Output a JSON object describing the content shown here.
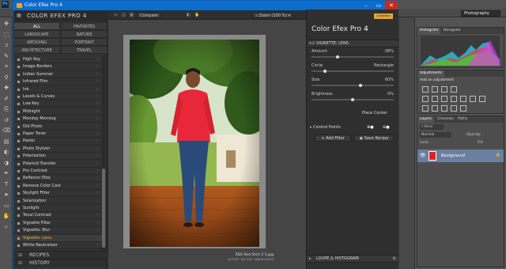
{
  "photoshop": {
    "logo": "Ps",
    "workspace": "Photography",
    "tool_icons": [
      "move-icon",
      "marquee-icon",
      "lasso-icon",
      "quick-select-icon",
      "crop-icon",
      "eyedropper-icon",
      "healing-icon",
      "brush-icon",
      "stamp-icon",
      "history-brush-icon",
      "eraser-icon",
      "gradient-icon",
      "blur-icon",
      "dodge-icon",
      "pen-icon",
      "type-icon",
      "path-select-icon",
      "shape-icon",
      "hand-icon",
      "zoom-icon"
    ],
    "histogram_panel": {
      "tabs": [
        "Histogram",
        "Navigator"
      ]
    },
    "adjustments_panel": {
      "tab": "Adjustments",
      "title": "Add an adjustment"
    },
    "layers_panel": {
      "tabs": [
        "Layers",
        "Channels",
        "Paths"
      ],
      "kind": "Kind",
      "blend_mode": "Normal",
      "opacity_label": "Opacity:",
      "lock_label": "Lock:",
      "fill_label": "Fill:",
      "layer_name": "Background"
    }
  },
  "plugin": {
    "title": "Color Efex Pro 4",
    "window_controls": {
      "minimize": "–",
      "restore": "▭",
      "close": "✕"
    },
    "filters_panel": {
      "logo": "COLOR EFEX PRO 4",
      "categories": [
        {
          "label": "ALL",
          "active": true
        },
        {
          "label": "FAVORITES",
          "active": false
        },
        {
          "label": "LANDSCAPE",
          "active": false
        },
        {
          "label": "NATURE",
          "active": false
        },
        {
          "label": "WEDDING",
          "active": false
        },
        {
          "label": "PORTRAIT",
          "active": false
        },
        {
          "label": "ARCHITECTURE",
          "active": false
        },
        {
          "label": "TRAVEL",
          "active": false
        }
      ],
      "filters": [
        "High Key",
        "Image Borders",
        "Indian Summer",
        "Infrared Film",
        "Ink",
        "Levels & Curves",
        "Low Key",
        "Midnight",
        "Monday Morning",
        "Old Photo",
        "Paper Toner",
        "Pastel",
        "Photo Stylizer",
        "Polarization",
        "Polaroid Transfer",
        "Pro Contrast",
        "Reflector Efex",
        "Remove Color Cast",
        "Skylight Filter",
        "Solarization",
        "Sunlight",
        "Tonal Contrast",
        "Vignette Filter",
        "Vignette: Blur",
        "Vignette: Lens",
        "White Neutralizer"
      ],
      "selected_filter": "Vignette: Lens",
      "recipes_label": "RECIPES",
      "history_label": "HISTORY"
    },
    "preview_toolbar": {
      "compare": "Compare",
      "zoom": "Zoom (100 %)"
    },
    "photo": {
      "caption": "RDS Red Shirt 2 5.jpg",
      "subcaption": "16.9 MP · ISO 200 · NIKON D3300"
    },
    "controls_panel": {
      "logo": "Color Efex Pro",
      "logo_version": "4",
      "badge": "Collection",
      "section_title": "VIGNETTE: LENS",
      "sliders": [
        {
          "label": "Amount",
          "value": "-38%",
          "pos": 0.31
        },
        {
          "label": "Circle",
          "value": "Rectangle",
          "pos": 0.15
        },
        {
          "label": "Size",
          "value": "60%",
          "pos": 0.6
        },
        {
          "label": "Brightness",
          "value": "0%",
          "pos": 0.5
        }
      ],
      "place_center": "Place Center",
      "control_points": "Control Points",
      "add_filter": "Add Filter",
      "save_recipe": "Save Recipe",
      "loupe": "LOUPE & HISTOGRAM"
    }
  }
}
